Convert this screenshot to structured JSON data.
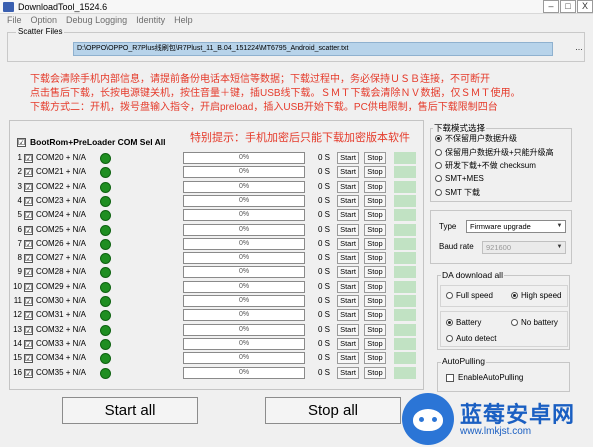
{
  "window": {
    "title": "DownloadTool_1524.6",
    "minimize": "–",
    "maximize": "□",
    "close": "X"
  },
  "menu": [
    "File",
    "Option",
    "Debug Logging",
    "Identity",
    "Help"
  ],
  "scatter": {
    "label": "Scatter Files",
    "path": "D:\\OPPO\\OPPO_R7Plus线刷包\\R7Plust_11_B.04_151224\\MT6795_Android_scatter.txt",
    "browse_symbol": "..."
  },
  "notices": [
    "下载会清除手机内部信息，请提前备份电话本短信等数据；下载过程中，务必保持ＵＳＢ连接，不可断开",
    "点击售后下载，长按电源键关机，按住音量＋键，插USB线下载。ＳＭＴ下载会清除ＮＶ数据，仅ＳＭＴ使用。",
    "下载方式二：开机，拨号盘输入指令，开启preload，插入USB开始下载。PC供电限制，售后下载限制四台"
  ],
  "device_list": {
    "header_checkbox": "☑",
    "header_label": "BootRom+PreLoader COM Sel All",
    "special_tip": "特别提示：手机加密后只能下载加密版本软件",
    "rows": [
      {
        "index": "1",
        "com": "COM20 + N/A",
        "progress": "0%",
        "time": "0 S",
        "start": "Start",
        "stop": "Stop"
      },
      {
        "index": "2",
        "com": "COM21 + N/A",
        "progress": "0%",
        "time": "0 S",
        "start": "Start",
        "stop": "Stop"
      },
      {
        "index": "3",
        "com": "COM22 + N/A",
        "progress": "0%",
        "time": "0 S",
        "start": "Start",
        "stop": "Stop"
      },
      {
        "index": "4",
        "com": "COM23 + N/A",
        "progress": "0%",
        "time": "0 S",
        "start": "Start",
        "stop": "Stop"
      },
      {
        "index": "5",
        "com": "COM24 + N/A",
        "progress": "0%",
        "time": "0 S",
        "start": "Start",
        "stop": "Stop"
      },
      {
        "index": "6",
        "com": "COM25 + N/A",
        "progress": "0%",
        "time": "0 S",
        "start": "Start",
        "stop": "Stop"
      },
      {
        "index": "7",
        "com": "COM26 + N/A",
        "progress": "0%",
        "time": "0 S",
        "start": "Start",
        "stop": "Stop"
      },
      {
        "index": "8",
        "com": "COM27 + N/A",
        "progress": "0%",
        "time": "0 S",
        "start": "Start",
        "stop": "Stop"
      },
      {
        "index": "9",
        "com": "COM28 + N/A",
        "progress": "0%",
        "time": "0 S",
        "start": "Start",
        "stop": "Stop"
      },
      {
        "index": "10",
        "com": "COM29 + N/A",
        "progress": "0%",
        "time": "0 S",
        "start": "Start",
        "stop": "Stop"
      },
      {
        "index": "11",
        "com": "COM30 + N/A",
        "progress": "0%",
        "time": "0 S",
        "start": "Start",
        "stop": "Stop"
      },
      {
        "index": "12",
        "com": "COM31 + N/A",
        "progress": "0%",
        "time": "0 S",
        "start": "Start",
        "stop": "Stop"
      },
      {
        "index": "13",
        "com": "COM32 + N/A",
        "progress": "0%",
        "time": "0 S",
        "start": "Start",
        "stop": "Stop"
      },
      {
        "index": "14",
        "com": "COM33 + N/A",
        "progress": "0%",
        "time": "0 S",
        "start": "Start",
        "stop": "Stop"
      },
      {
        "index": "15",
        "com": "COM34 + N/A",
        "progress": "0%",
        "time": "0 S",
        "start": "Start",
        "stop": "Stop"
      },
      {
        "index": "16",
        "com": "COM35 + N/A",
        "progress": "0%",
        "time": "0 S",
        "start": "Start",
        "stop": "Stop"
      }
    ]
  },
  "buttons": {
    "start_all": "Start all",
    "stop_all": "Stop all"
  },
  "download_mode": {
    "title": "下载模式选择",
    "options": [
      {
        "label": "不保留用户数据升级",
        "selected": true
      },
      {
        "label": "保留用户数据升级+只能升级高",
        "selected": false
      },
      {
        "label": "研发下载+不做 checksum",
        "selected": false
      },
      {
        "label": "SMT+MES",
        "selected": false
      },
      {
        "label": "SMT 下载",
        "selected": false
      }
    ]
  },
  "type_panel": {
    "type_label": "Type",
    "type_value": "Firmware upgrade",
    "baud_label": "Baud rate",
    "baud_value": "921600",
    "arrow": "▼"
  },
  "da_download": {
    "title": "DA download all",
    "full_speed": "Full speed",
    "high_speed": "High speed",
    "speed_selected": "high",
    "battery": "Battery",
    "no_battery": "No battery",
    "auto_detect": "Auto detect",
    "battery_selected": "battery"
  },
  "auto_pulling": {
    "title": "AutoPulling",
    "checkbox_label": "EnableAutoPulling"
  },
  "watermark": {
    "brand": "蓝莓安卓网",
    "url": "www.lmkjst.com"
  },
  "colors": {
    "notice_red": "#e53a2a",
    "led_green": "#1f8e21",
    "status_cell": "#c1e2c3",
    "scatter_path_bg": "#b7d3ea",
    "brand_blue": "#1a5fc2"
  }
}
